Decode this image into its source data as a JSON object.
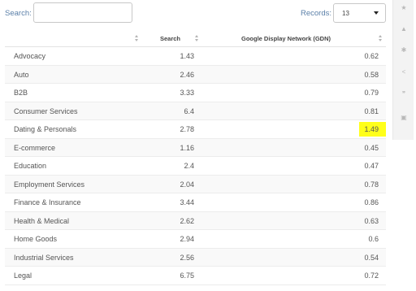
{
  "search": {
    "label": "Search:",
    "value": "",
    "placeholder": ""
  },
  "records": {
    "label": "Records:",
    "value": "13"
  },
  "columns": {
    "search": "Search",
    "gdn": "Google Display Network (GDN)"
  },
  "rows": [
    {
      "name": "Advocacy",
      "search": "1.43",
      "gdn": "0.62"
    },
    {
      "name": "Auto",
      "search": "2.46",
      "gdn": "0.58"
    },
    {
      "name": "B2B",
      "search": "3.33",
      "gdn": "0.79"
    },
    {
      "name": "Consumer Services",
      "search": "6.4",
      "gdn": "0.81"
    },
    {
      "name": "Dating & Personals",
      "search": "2.78",
      "gdn": "1.49",
      "highlight_color": "#ffff1a"
    },
    {
      "name": "E-commerce",
      "search": "1.16",
      "gdn": "0.45"
    },
    {
      "name": "Education",
      "search": "2.4",
      "gdn": "0.47"
    },
    {
      "name": "Employment Services",
      "search": "2.04",
      "gdn": "0.78"
    },
    {
      "name": "Finance & Insurance",
      "search": "3.44",
      "gdn": "0.86"
    },
    {
      "name": "Health & Medical",
      "search": "2.62",
      "gdn": "0.63"
    },
    {
      "name": "Home Goods",
      "search": "2.94",
      "gdn": "0.6"
    },
    {
      "name": "Industrial Services",
      "search": "2.56",
      "gdn": "0.54"
    },
    {
      "name": "Legal",
      "search": "6.75",
      "gdn": "0.72"
    }
  ],
  "sidebar_icons": [
    {
      "name": "star-icon",
      "glyph": "★"
    },
    {
      "name": "bell-icon",
      "glyph": "▲"
    },
    {
      "name": "gear-icon",
      "glyph": "✱"
    },
    {
      "name": "share-icon",
      "glyph": "<"
    },
    {
      "name": "quote-icon",
      "glyph": "❞"
    },
    {
      "name": "print-icon",
      "glyph": "▣"
    }
  ],
  "colors": {
    "label_blue": "#5a7fa8",
    "highlight": "#ffff1a"
  }
}
